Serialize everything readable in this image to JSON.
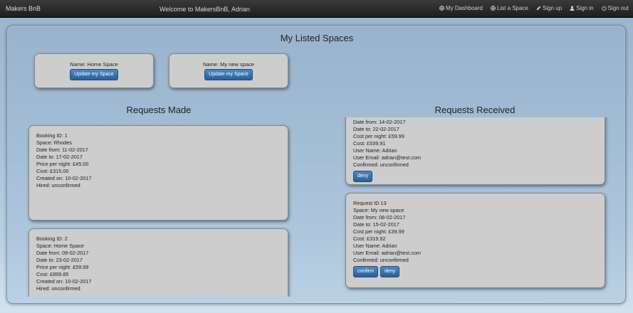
{
  "navbar": {
    "brand": "Makers BnB",
    "welcome": "Welcome to MakersBnB, Adrian",
    "links": [
      {
        "label": "My Dashboard",
        "icon": "globe-icon"
      },
      {
        "label": "List a Space",
        "icon": "globe-icon"
      },
      {
        "label": "Sign up",
        "icon": "pencil-icon"
      },
      {
        "label": "Sign in",
        "icon": "user-icon"
      },
      {
        "label": "Sign out",
        "icon": "power-icon"
      }
    ]
  },
  "listed": {
    "title": "My Listed Spaces",
    "spaces": [
      {
        "name": "Name: Home Space",
        "button": "Update my Space"
      },
      {
        "name": "Name: My new space",
        "button": "Update my Space"
      }
    ]
  },
  "made": {
    "title": "Requests Made",
    "bookings": [
      {
        "lines": [
          "Booking ID: 1",
          "Space: Rhodes",
          "Date from: 11-02-2017",
          "Date to: 17-02-2017",
          "Price per night: £45.00",
          "Cost: £315.00",
          "Created on: 10-02-2017",
          "Hired: unconfirmed"
        ]
      },
      {
        "lines": [
          "Booking ID: 2",
          "Space: Home Space",
          "Date from: 09-02-2017",
          "Date to: 23-02-2017",
          "Price per night: £59.99",
          "Cost: £899.85",
          "Created on: 10-02-2017",
          "Hired: unconfirmed"
        ]
      }
    ]
  },
  "received": {
    "title": "Requests Received",
    "requests": [
      {
        "lines": [
          "Date from: 14-02-2017",
          "Date to: 22-02-2017",
          "Cost per night: £59.99",
          "Cost: £539.91",
          "User Name: Adrian",
          "User Email: adrian@test.com",
          "Confirmed: unconfirmed"
        ],
        "deny": "deny"
      },
      {
        "lines": [
          "Request ID 13",
          "Space: My new space",
          "Date from: 08-02-2017",
          "Date to: 15-02-2017",
          "Cost per night: £39.99",
          "Cost: £319.92",
          "User Name: Adrian",
          "User Email: adrian@test.com",
          "Confirmed: unconfirmed"
        ],
        "confirm": "confirm",
        "deny": "deny"
      }
    ]
  }
}
